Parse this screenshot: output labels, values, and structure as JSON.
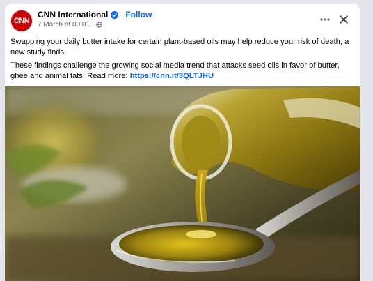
{
  "post": {
    "page_name": "CNN International",
    "avatar_text": "CNN",
    "separator": "·",
    "follow_label": "Follow",
    "timestamp": "7 March at 00:01 ·",
    "paragraph_1": "Swapping your daily butter intake for certain plant-based oils may help reduce your risk of death, a new study finds.",
    "paragraph_2_text": "These findings challenge the growing social media trend that attacks seed oils in favor of butter, ghee and animal fats. Read more: ",
    "paragraph_2_link": "https://cnn.it/3QLTJHU"
  },
  "icons": {
    "verified": "verified-badge-icon",
    "privacy": "globe-icon",
    "more": "more-horizontal-icon",
    "close": "close-icon"
  },
  "colors": {
    "brand_red": "#cc0000",
    "link_blue": "#0866ff",
    "secondary_text": "#65676b",
    "page_background": "#e4e6eb"
  }
}
